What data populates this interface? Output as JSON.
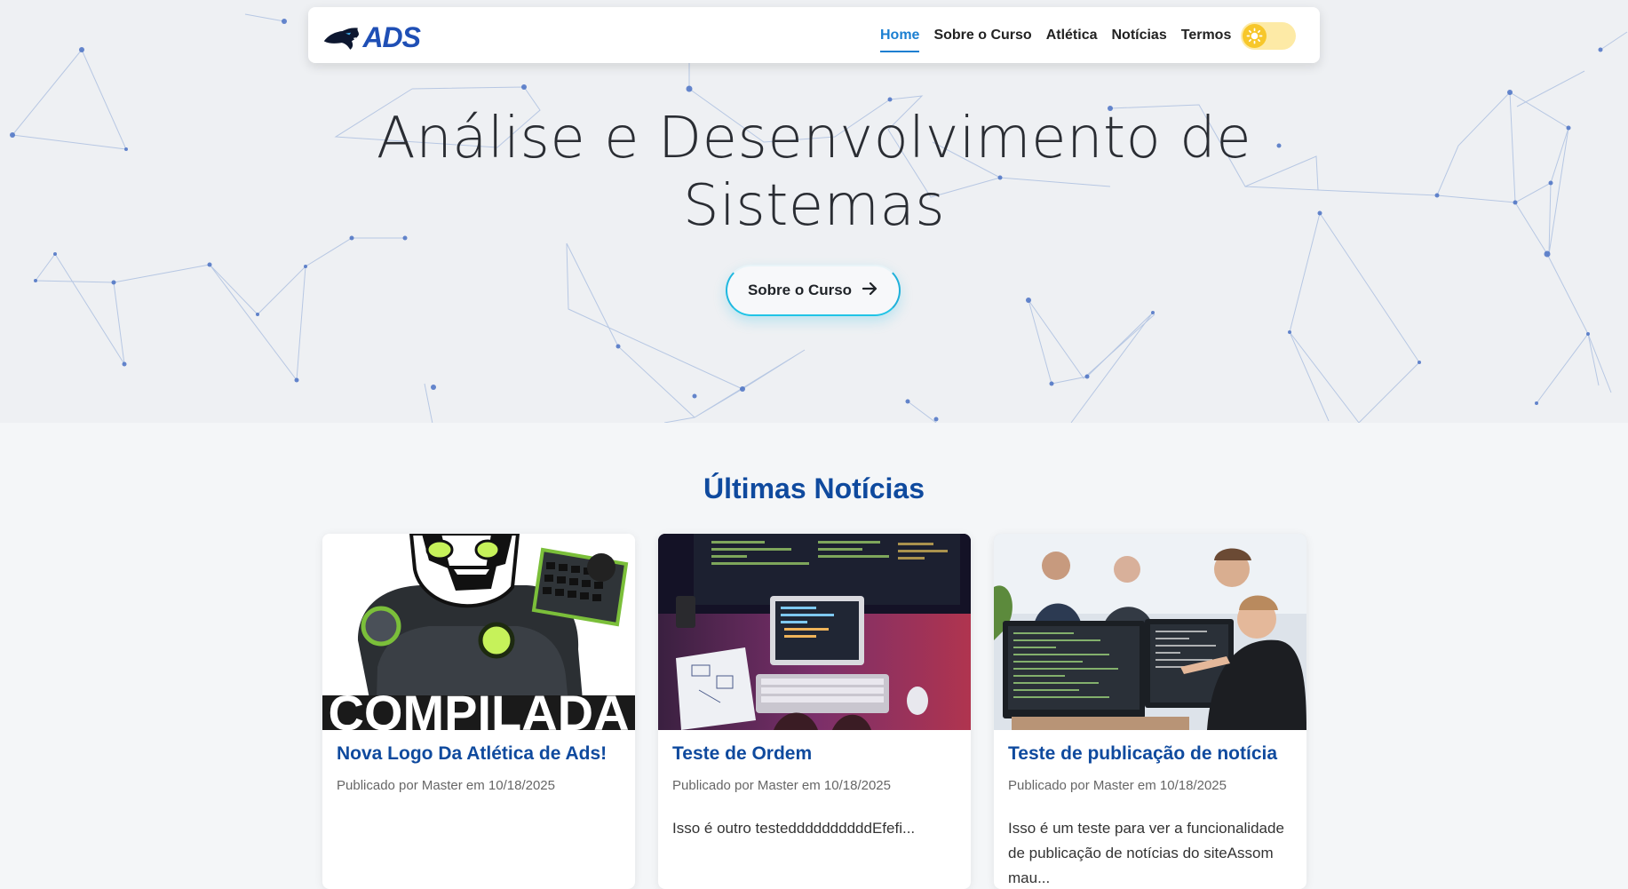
{
  "navbar": {
    "logo_text": "ADS",
    "links": [
      {
        "label": "Home",
        "active": true
      },
      {
        "label": "Sobre o Curso",
        "active": false
      },
      {
        "label": "Atlética",
        "active": false
      },
      {
        "label": "Notícias",
        "active": false
      },
      {
        "label": "Termos",
        "active": false
      }
    ],
    "theme_toggle": "light"
  },
  "hero": {
    "title_line1": "Análise e Desenvolvimento de",
    "title_line2": "Sistemas",
    "button_label": "Sobre o Curso"
  },
  "news": {
    "heading": "Últimas Notícias",
    "cards": [
      {
        "title": "Nova Logo Da Atlética de Ads!",
        "meta": "Publicado por Master em 10/18/2025",
        "excerpt": "",
        "image": "mascot-logo-compilada",
        "image_text": "COMPILADA"
      },
      {
        "title": "Teste de Ordem",
        "meta": "Publicado por Master em 10/18/2025",
        "excerpt": "Isso é outro testeddddddddddEfefi...",
        "image": "laptop-keyboard-code"
      },
      {
        "title": "Teste de publicação de notícia",
        "meta": "Publicado por Master em 10/18/2025",
        "excerpt": "Isso é um teste para ver a funcionalidade de publicação de notícias do siteAssom mau...",
        "image": "developers-at-monitors"
      }
    ]
  },
  "colors": {
    "accent": "#1b7fd1",
    "heading": "#0f4a9e",
    "button_glow": "#20b8e0",
    "toggle": "#f7c72a"
  }
}
